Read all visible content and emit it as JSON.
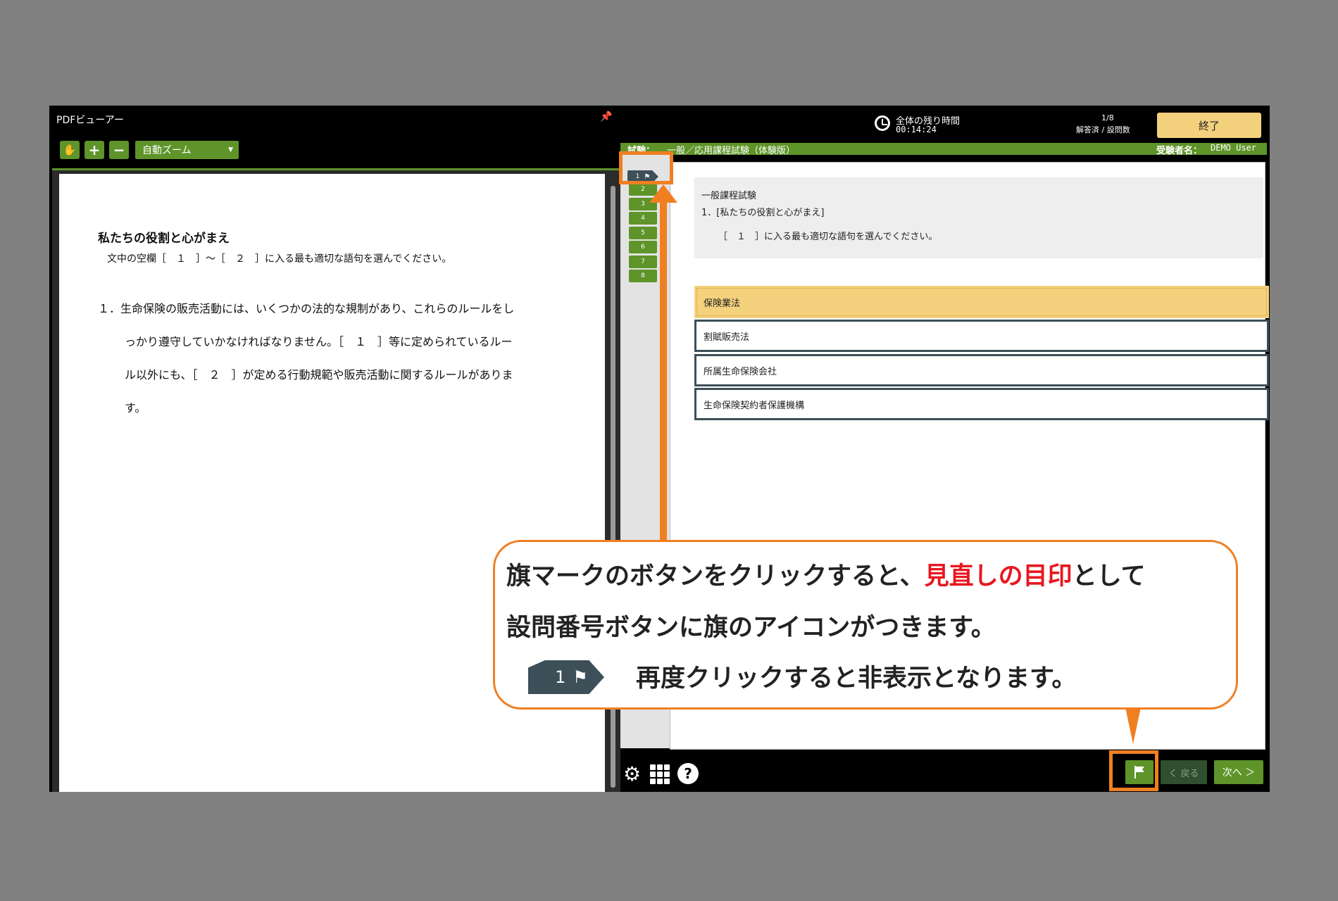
{
  "pdf": {
    "title": "PDFビューアー",
    "zoom_label": "自動ズーム",
    "heading": "私たちの役割と心がまえ",
    "instruction": "文中の空欄［　１　］～［　２　］に入る最も適切な語句を選んでください。",
    "body_lines": [
      "１．生命保険の販売活動には、いくつかの法的な規制があり、これらのルールをし",
      "っかり遵守していかなければなりません。［　１　］等に定められているルー",
      "ル以外にも、［　２　］が定める行動規範や販売活動に関するルールがありま",
      "す。"
    ]
  },
  "header": {
    "time_label": "全体の残り時間",
    "time_value": "00:14:24",
    "progress_value": "1/8",
    "progress_label": "解答済 / 設問数",
    "end_label": "終了"
  },
  "exam": {
    "exam_label": "試験：",
    "exam_name": "一般／応用課程試験（体験版）",
    "examinee_label": "受験者名：",
    "examinee_name": "DEMO User"
  },
  "question_nav": [
    "1",
    "2",
    "3",
    "4",
    "5",
    "6",
    "7",
    "8"
  ],
  "question": {
    "category": "一般課程試験",
    "title": "1．[私たちの役割と心がまえ]",
    "text": "［　１　］に入る最も適切な語句を選んでください。"
  },
  "options": [
    "保険業法",
    "割賦販売法",
    "所属生命保険会社",
    "生命保険契約者保護機構"
  ],
  "selected_option": 0,
  "footer": {
    "back_label": "く 戻る",
    "next_label": "次へ ＞"
  },
  "callout": {
    "line1_a": "旗マークのボタンをクリックすると、",
    "line1_red": "見直しの目印",
    "line1_b": "として",
    "line2": "設問番号ボタンに旗のアイコンがつきます。",
    "badge_number": "1",
    "line3": "再度クリックすると非表示となります。"
  },
  "colors": {
    "accent_green": "#5e9429",
    "highlight_orange": "#f07f22",
    "selected_yellow": "#f4d17d",
    "emphasis_red": "#e8171f",
    "flag_dark": "#3d4f58"
  }
}
